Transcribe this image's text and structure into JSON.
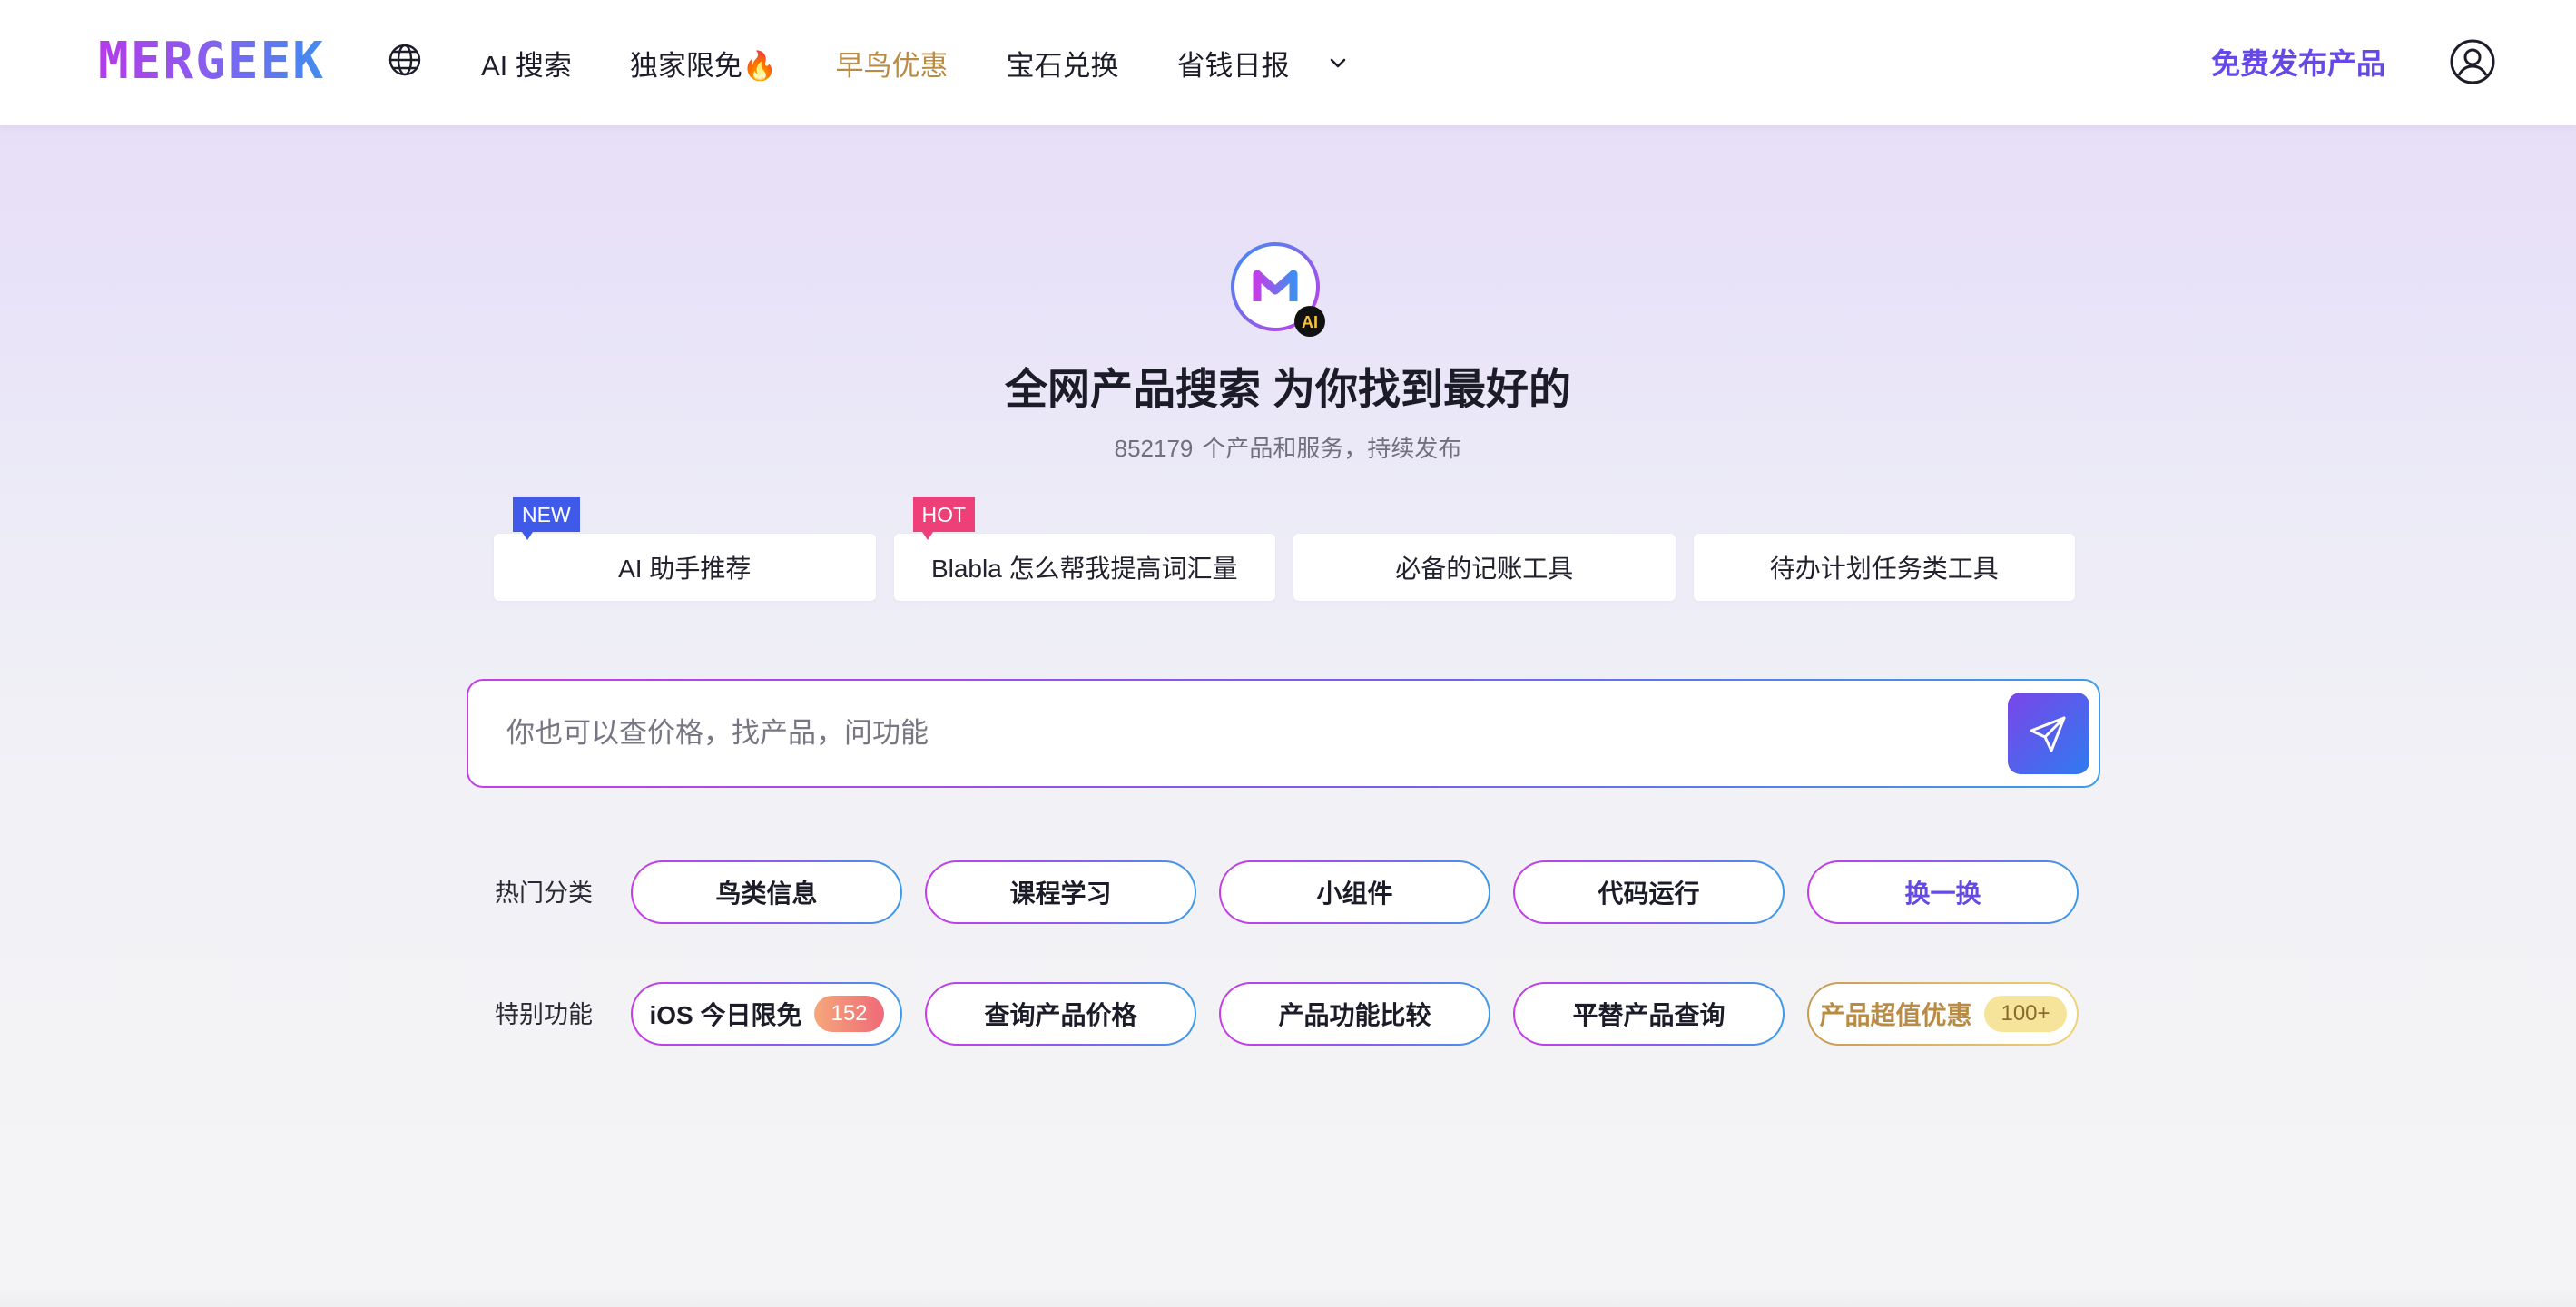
{
  "header": {
    "logo_text": "MERGEEK",
    "nav": [
      {
        "label": "AI 搜索",
        "accent": false
      },
      {
        "label": "独家限免🔥",
        "accent": false
      },
      {
        "label": "早鸟优惠",
        "accent": true
      },
      {
        "label": "宝石兑换",
        "accent": false
      },
      {
        "label": "省钱日报",
        "accent": false
      }
    ],
    "publish_label": "免费发布产品",
    "icons": [
      "globe-icon",
      "chevron-down-icon",
      "user-icon"
    ]
  },
  "hero": {
    "logo_badge": "AI",
    "title": "全网产品搜索 为你找到最好的",
    "count": "852179",
    "subtitle": "个产品和服务，持续发布"
  },
  "suggestions": [
    {
      "label": "AI 助手推荐",
      "tag": "NEW"
    },
    {
      "label": "Blabla 怎么帮我提高词汇量",
      "tag": "HOT"
    },
    {
      "label": "必备的记账工具",
      "tag": ""
    },
    {
      "label": "待办计划任务类工具",
      "tag": ""
    }
  ],
  "search": {
    "placeholder": "你也可以查价格，找产品，问功能",
    "value": ""
  },
  "hot_categories": {
    "label": "热门分类",
    "items": [
      "鸟类信息",
      "课程学习",
      "小组件",
      "代码运行"
    ],
    "refresh_label": "换一换"
  },
  "special_features": {
    "label": "特别功能",
    "items": [
      {
        "label": "iOS 今日限免",
        "badge": "152"
      },
      {
        "label": "查询产品价格",
        "badge": ""
      },
      {
        "label": "产品功能比较",
        "badge": ""
      },
      {
        "label": "平替产品查询",
        "badge": ""
      },
      {
        "label": "产品超值优惠",
        "badge": "100+"
      }
    ]
  },
  "colors": {
    "brand_purple": "#6548e6",
    "gold": "#b98c45",
    "new_tag": "#3f5ae8",
    "hot_tag": "#ee3f78"
  }
}
